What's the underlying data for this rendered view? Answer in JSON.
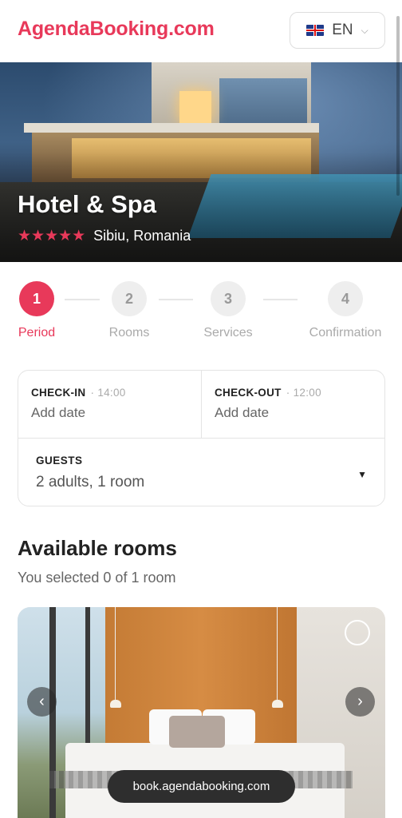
{
  "header": {
    "brand": "AgendaBooking.com",
    "language": "EN",
    "flag_icon": "uk-flag-icon"
  },
  "hero": {
    "title": "Hotel & Spa",
    "stars": "★★★★★",
    "rating": 5,
    "location": "Sibiu, Romania"
  },
  "stepper": {
    "steps": [
      {
        "number": "1",
        "label": "Period",
        "active": true
      },
      {
        "number": "2",
        "label": "Rooms",
        "active": false
      },
      {
        "number": "3",
        "label": "Services",
        "active": false
      },
      {
        "number": "4",
        "label": "Confirmation",
        "active": false
      }
    ]
  },
  "booking": {
    "checkin_label": "CHECK-IN",
    "checkin_time": "· 14:00",
    "checkin_value": "Add date",
    "checkout_label": "CHECK-OUT",
    "checkout_time": "· 12:00",
    "checkout_value": "Add date",
    "guests_label": "GUESTS",
    "guests_value": "2 adults, 1 room",
    "guests_caret": "▼"
  },
  "rooms": {
    "title": "Available rooms",
    "subtitle": "You selected 0 of 1 room",
    "prev_icon": "‹",
    "next_icon": "›"
  },
  "footer": {
    "url": "book.agendabooking.com"
  },
  "colors": {
    "accent": "#e8395a"
  }
}
